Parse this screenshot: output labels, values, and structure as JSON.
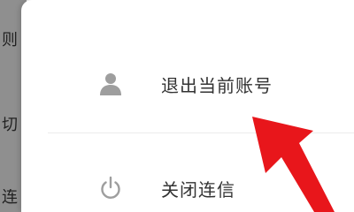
{
  "background_menu": {
    "partial_chars": [
      "则",
      "切",
      "连"
    ]
  },
  "menu": {
    "items": [
      {
        "label": "退出当前账号",
        "icon": "user-icon"
      },
      {
        "label": "关闭连信",
        "icon": "power-icon"
      }
    ]
  },
  "colors": {
    "icon_gray": "#9e9e9e",
    "text": "#333333",
    "arrow": "#e8161b",
    "side_panel": "#8f8f8f"
  },
  "annotation": {
    "icon": "red-arrow-pointer"
  }
}
